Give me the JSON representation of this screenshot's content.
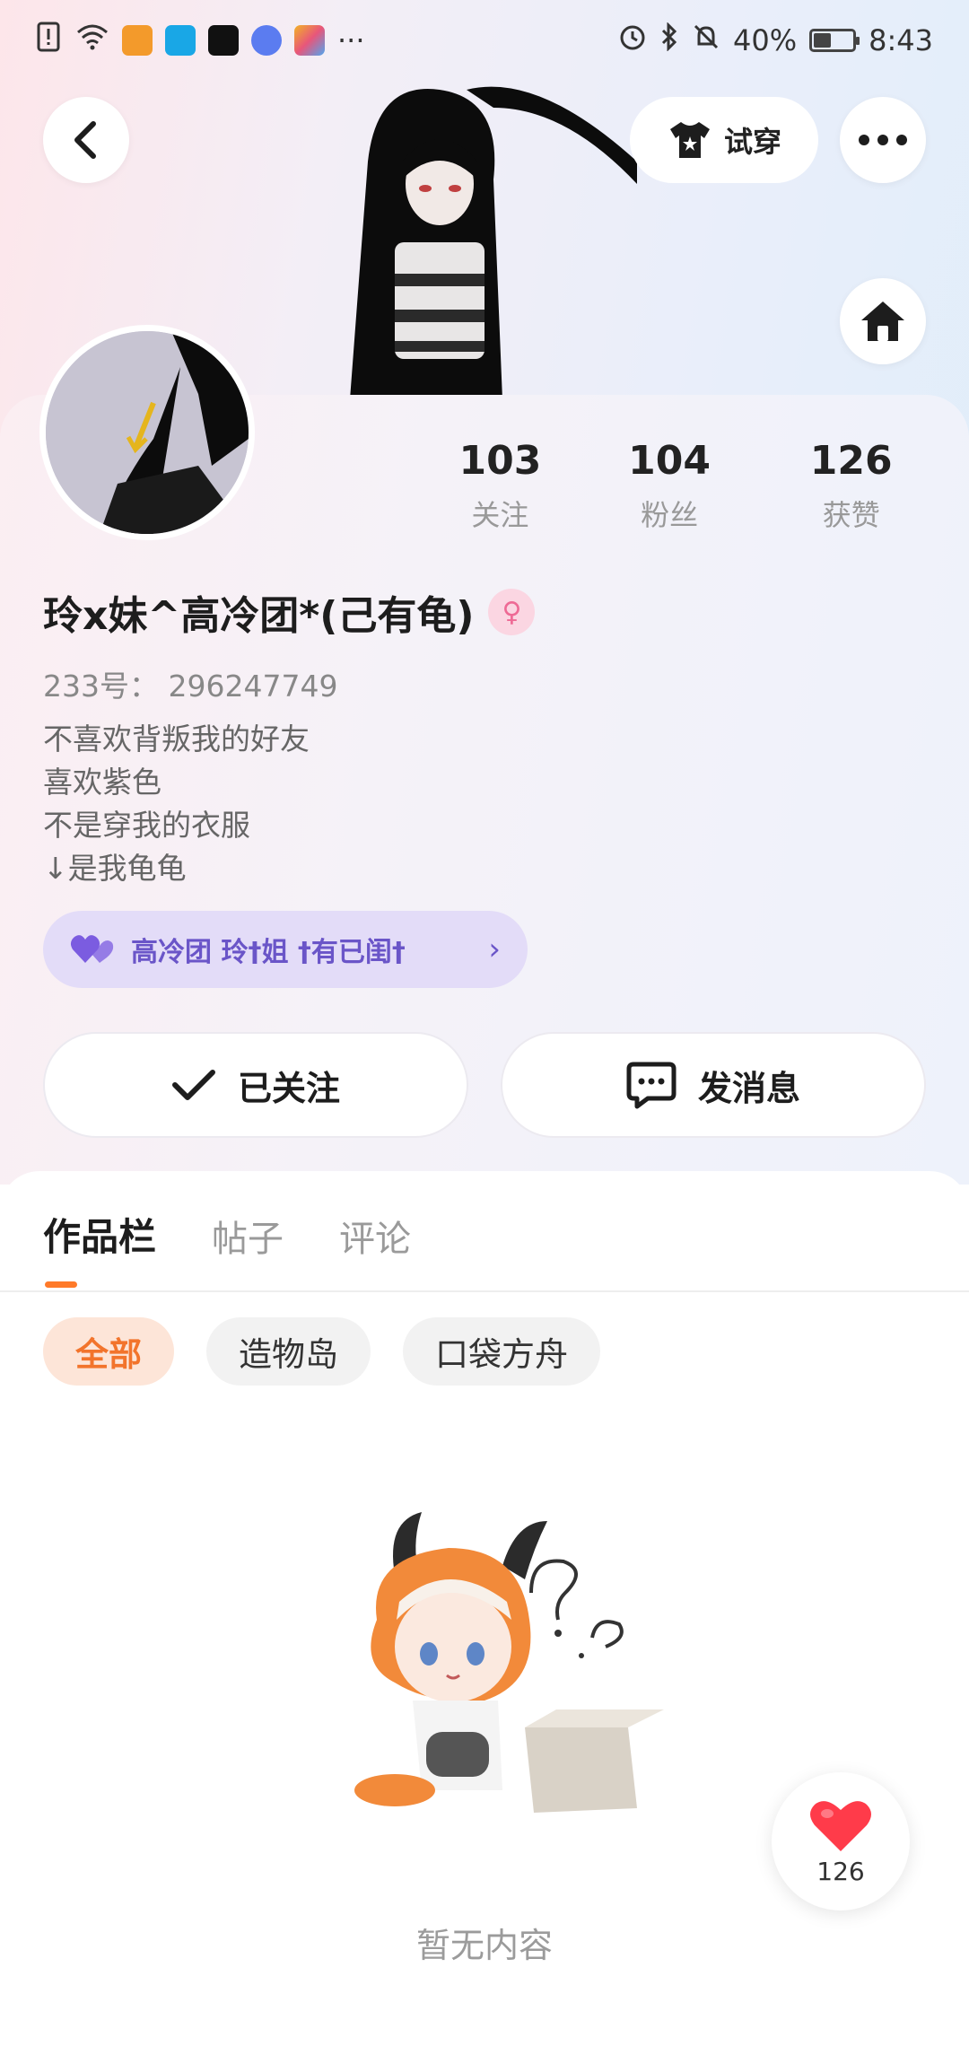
{
  "status_bar": {
    "battery": "40%",
    "time": "8:43",
    "more_indicator": "···",
    "app_icon_colors": [
      "#f39a2b",
      "#19a7e6",
      "#111111",
      "#5b7cf0",
      "#f2b326"
    ],
    "icons": [
      "alert-icon",
      "wifi-icon",
      "alarm-icon",
      "bluetooth-icon",
      "mute-icon",
      "battery-icon"
    ]
  },
  "header": {
    "try_on_label": "试穿",
    "back_icon": "chevron-left-icon",
    "more_icon": "more-dots-icon",
    "home_icon": "home-icon"
  },
  "profile": {
    "stats": [
      {
        "value": "103",
        "label": "关注"
      },
      {
        "value": "104",
        "label": "粉丝"
      },
      {
        "value": "126",
        "label": "获赞"
      }
    ],
    "name": "玲x妹^高冷团*(己有龟)",
    "gender_icon": "female-icon",
    "uid": "233号：  296247749",
    "bio_lines": [
      "不喜欢背叛我的好友",
      "喜欢紫色",
      "不是穿我的衣服",
      "↓是我龟龟"
    ],
    "group_chip": "高冷团  玲†姐 †有已闺†",
    "followed_label": "已关注",
    "message_label": "发消息"
  },
  "content": {
    "tabs": [
      "作品栏",
      "帖子",
      "评论"
    ],
    "active_tab": 0,
    "filters": [
      "全部",
      "造物岛",
      "口袋方舟"
    ],
    "active_filter": 0,
    "empty_text": "暂无内容"
  },
  "like_float": {
    "count": "126"
  },
  "colors": {
    "accent": "#ff7a29",
    "chip_purple": "#6a55c8",
    "heart": "#ff3b4a"
  }
}
